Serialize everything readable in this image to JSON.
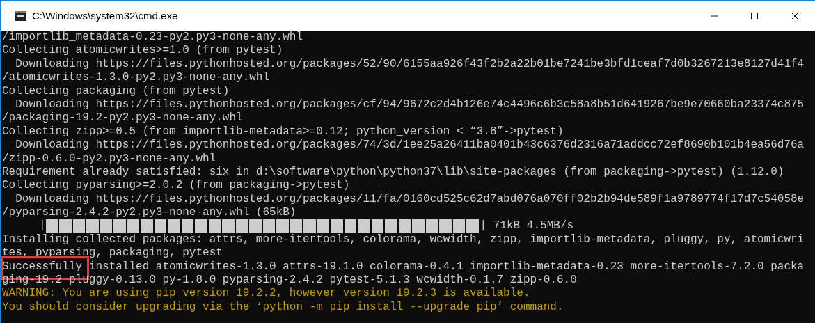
{
  "window": {
    "title": "C:\\Windows\\system32\\cmd.exe"
  },
  "console": {
    "lines": [
      {
        "kind": "text",
        "text": "/importlib_metadata-0.23-py2.py3-none-any.whl",
        "color": "#cccccc",
        "highlighted": false
      },
      {
        "kind": "text",
        "text": "Collecting atomicwrites>=1.0 (from pytest)",
        "color": "#cccccc",
        "highlighted": false
      },
      {
        "kind": "text",
        "text": "  Downloading https://files.pythonhosted.org/packages/52/90/6155aa926f43f2b2a22b01be7241be3bfd1ceaf7d0b3267213e8127d41f4",
        "color": "#cccccc",
        "highlighted": false
      },
      {
        "kind": "text",
        "text": "/atomicwrites-1.3.0-py2.py3-none-any.whl",
        "color": "#cccccc",
        "highlighted": false
      },
      {
        "kind": "text",
        "text": "Collecting packaging (from pytest)",
        "color": "#cccccc",
        "highlighted": false
      },
      {
        "kind": "text",
        "text": "  Downloading https://files.pythonhosted.org/packages/cf/94/9672c2d4b126e74c4496c6b3c58a8b51d6419267be9e70660ba23374c875",
        "color": "#cccccc",
        "highlighted": false
      },
      {
        "kind": "text",
        "text": "/packaging-19.2-py2.py3-none-any.whl",
        "color": "#cccccc",
        "highlighted": false
      },
      {
        "kind": "text",
        "text": "Collecting zipp>=0.5 (from importlib-metadata>=0.12; python_version < “3.8”->pytest)",
        "color": "#cccccc",
        "highlighted": false
      },
      {
        "kind": "text",
        "text": "  Downloading https://files.pythonhosted.org/packages/74/3d/1ee25a26411ba0401b43c6376d2316a71addcc72ef8690b101b4ea56d76a",
        "color": "#cccccc",
        "highlighted": false
      },
      {
        "kind": "text",
        "text": "/zipp-0.6.0-py2.py3-none-any.whl",
        "color": "#cccccc",
        "highlighted": false
      },
      {
        "kind": "text",
        "text": "Requirement already satisfied: six in d:\\software\\python\\python37\\lib\\site-packages (from packaging->pytest) (1.12.0)",
        "color": "#cccccc",
        "highlighted": false
      },
      {
        "kind": "text",
        "text": "Collecting pyparsing>=2.0.2 (from packaging->pytest)",
        "color": "#cccccc",
        "highlighted": false
      },
      {
        "kind": "text",
        "text": "  Downloading https://files.pythonhosted.org/packages/11/fa/0160cd525c62d7abd076a070ff02b2b94de589f1a9789774f17d7c54058e",
        "color": "#cccccc",
        "highlighted": false
      },
      {
        "kind": "text",
        "text": "/pyparsing-2.4.2-py2.py3-none-any.whl (65kB)",
        "color": "#cccccc",
        "highlighted": false
      },
      {
        "kind": "progress",
        "start": "|",
        "end": "| 71kB 4.5MB/s",
        "color": "#cccccc",
        "highlighted": false
      },
      {
        "kind": "text",
        "text": "Installing collected packages: attrs, more-itertools, colorama, wcwidth, zipp, importlib-metadata, pluggy, py, atomicwri",
        "color": "#cccccc",
        "highlighted": false
      },
      {
        "kind": "text",
        "text": "tes, pyparsing, packaging, pytest",
        "color": "#cccccc",
        "highlighted": false
      },
      {
        "kind": "text",
        "text": "Successfully installed atomicwrites-1.3.0 attrs-19.1.0 colorama-0.4.1 importlib-metadata-0.23 more-itertools-7.2.0 packa",
        "color": "#cccccc",
        "highlighted": true
      },
      {
        "kind": "text",
        "text": "ging-19.2 pluggy-0.13.0 py-1.8.0 pyparsing-2.4.2 pytest-5.1.3 wcwidth-0.1.7 zipp-0.6.0",
        "color": "#cccccc",
        "highlighted": false
      },
      {
        "kind": "text",
        "text": "WARNING: You are using pip version 19.2.2, however version 19.2.3 is available.",
        "color": "#c19c00",
        "highlighted": false
      },
      {
        "kind": "text",
        "text": "You should consider upgrading via the ‘python -m pip install --upgrade pip’ command.",
        "color": "#c19c00",
        "highlighted": false
      }
    ]
  }
}
